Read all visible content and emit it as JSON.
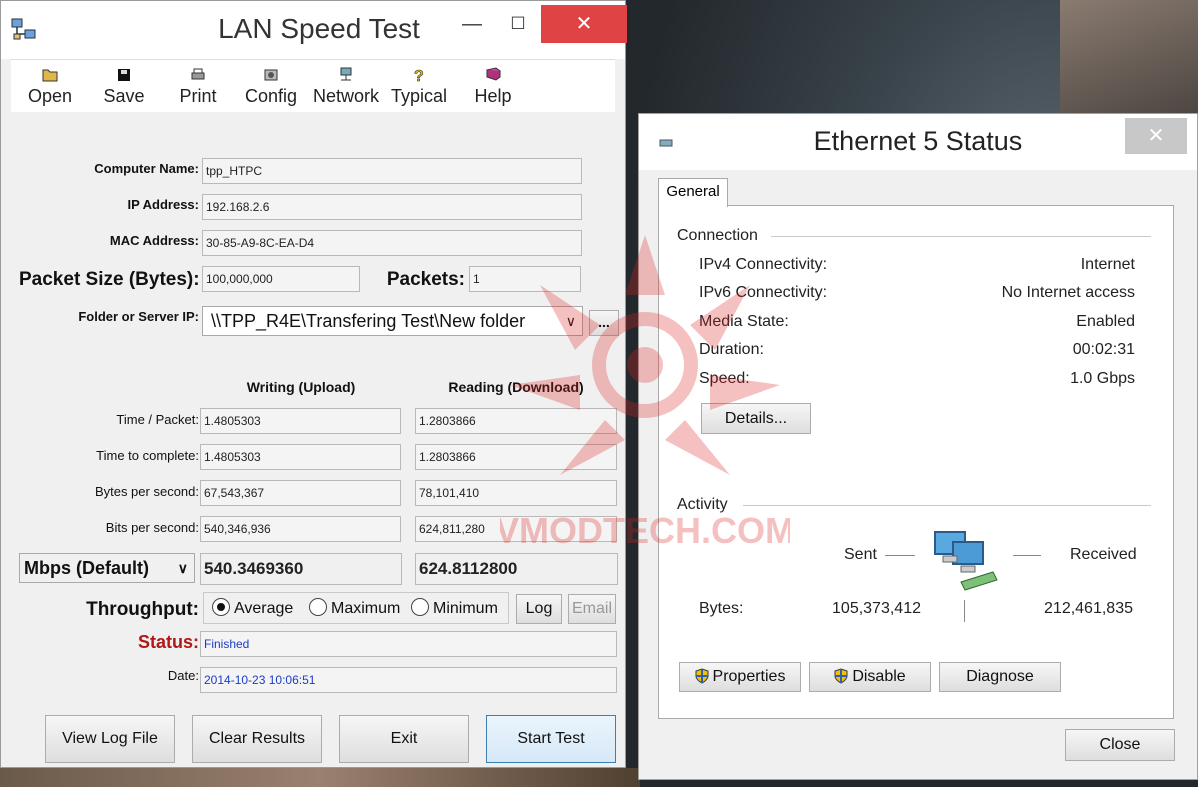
{
  "lan": {
    "title": "LAN Speed Test",
    "minimize": "—",
    "maximize": "☐",
    "close": "✕",
    "menu": [
      {
        "label": "Open",
        "icon": "open-folder-icon"
      },
      {
        "label": "Save",
        "icon": "save-disk-icon"
      },
      {
        "label": "Print",
        "icon": "printer-icon"
      },
      {
        "label": "Config",
        "icon": "config-icon"
      },
      {
        "label": "Network",
        "icon": "network-icon"
      },
      {
        "label": "Typical",
        "icon": "help-question-icon"
      },
      {
        "label": "Help",
        "icon": "help-book-icon"
      }
    ],
    "computer_name_label": "Computer Name:",
    "computer_name": "tpp_HTPC",
    "ip_label": "IP Address:",
    "ip": "192.168.2.6",
    "mac_label": "MAC Address:",
    "mac": "30-85-A9-8C-EA-D4",
    "packet_size_label": "Packet Size (Bytes):",
    "packet_size": "100,000,000",
    "packets_label": "Packets:",
    "packets": "1",
    "folder_label": "Folder or Server IP:",
    "folder": "\\\\TPP_R4E\\Transfering Test\\New folder",
    "browse": "...",
    "col_write": "Writing (Upload)",
    "col_read": "Reading (Download)",
    "rows": [
      {
        "label": "Time / Packet:",
        "write": "1.4805303",
        "read": "1.2803866"
      },
      {
        "label": "Time to complete:",
        "write": "1.4805303",
        "read": "1.2803866"
      },
      {
        "label": "Bytes per second:",
        "write": "67,543,367",
        "read": "78,101,410"
      },
      {
        "label": "Bits per second:",
        "write": "540,346,936",
        "read": "624,811,280"
      }
    ],
    "unit_select": "Mbps (Default)",
    "mbps_write": "540.3469360",
    "mbps_read": "624.8112800",
    "throughput_label": "Throughput:",
    "radio": [
      "Average",
      "Maximum",
      "Minimum"
    ],
    "radio_selected": "Average",
    "log_button": "Log",
    "email_button": "Email",
    "status_label": "Status:",
    "status": "Finished",
    "date_label": "Date:",
    "date": "2014-10-23 10:06:51",
    "buttons": [
      "View Log File",
      "Clear Results",
      "Exit",
      "Start Test"
    ]
  },
  "watermark": "VMODTECH.COM",
  "eth": {
    "title": "Ethernet 5 Status",
    "close": "✕",
    "tab": "General",
    "connection_heading": "Connection",
    "connection": [
      {
        "label": "IPv4 Connectivity:",
        "value": "Internet"
      },
      {
        "label": "IPv6 Connectivity:",
        "value": "No Internet access"
      },
      {
        "label": "Media State:",
        "value": "Enabled"
      },
      {
        "label": "Duration:",
        "value": "00:02:31"
      },
      {
        "label": "Speed:",
        "value": "1.0 Gbps"
      }
    ],
    "details_button": "Details...",
    "activity_heading": "Activity",
    "sent_label": "Sent",
    "received_label": "Received",
    "bytes_label": "Bytes:",
    "bytes_sent": "105,373,412",
    "bytes_received": "212,461,835",
    "properties_button": "Properties",
    "disable_button": "Disable",
    "diagnose_button": "Diagnose",
    "close_button": "Close"
  },
  "colors": {
    "status_red": "#b01818",
    "value_blue": "#1a3cc8",
    "close_red": "#e04343"
  }
}
